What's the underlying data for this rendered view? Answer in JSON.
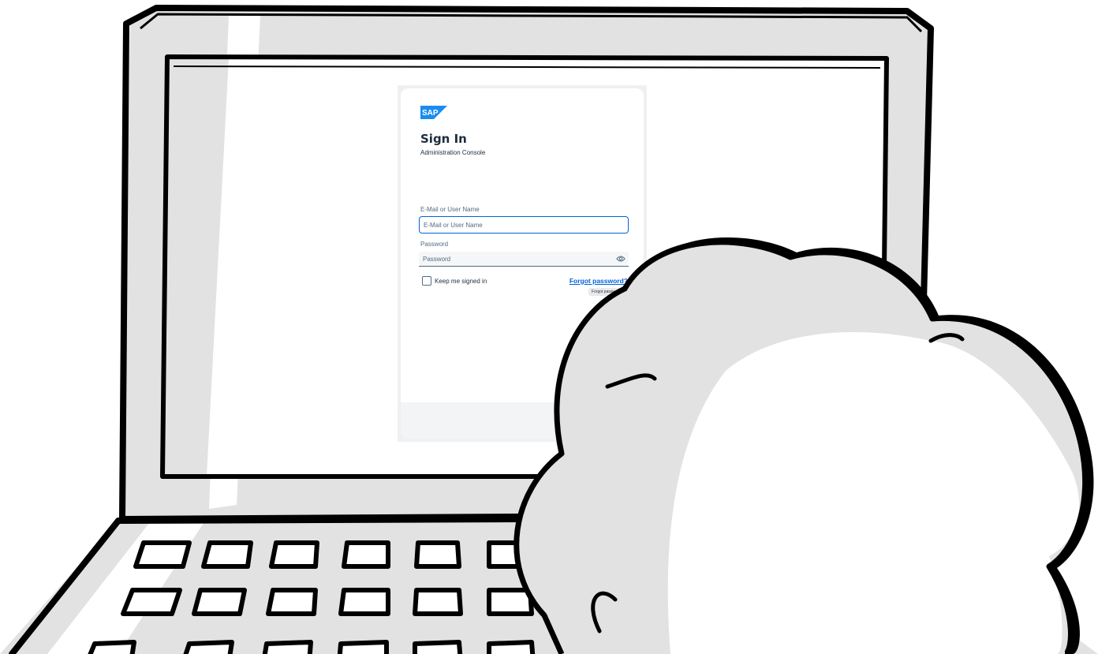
{
  "login": {
    "logo_text": "SAP",
    "title": "Sign In",
    "subtitle": "Administration Console",
    "email": {
      "label": "E-Mail or User Name",
      "placeholder": "E-Mail or User Name"
    },
    "password": {
      "label": "Password",
      "placeholder": "Password",
      "reveal_icon": "eye-icon"
    },
    "keep_signed_in": {
      "label": "Keep me signed in",
      "checked": false
    },
    "forgot_password": {
      "label": "Forgot password?",
      "tooltip": "Forgot password?"
    }
  },
  "colors": {
    "brand_blue": "#0064d9",
    "sap_logo": "#1a8cf0",
    "text_dark": "#1d2d3e",
    "illustration_gray": "#e2e2e2",
    "outline": "#000000"
  }
}
